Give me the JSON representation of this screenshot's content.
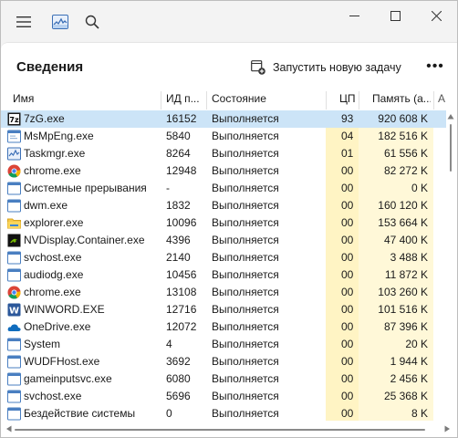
{
  "page": {
    "title": "Сведения",
    "new_task_label": "Запустить новую задачу",
    "more_label": "•••"
  },
  "columns": {
    "name": "Имя",
    "pid": "ИД п...",
    "status": "Состояние",
    "cpu": "ЦП",
    "memory": "Память (а..."
  },
  "rows": [
    {
      "name": "7zG.exe",
      "icon": "7zip-icon",
      "pid": "16152",
      "status": "Выполняется",
      "cpu": "93",
      "memory": "920 608 K",
      "selected": true
    },
    {
      "name": "MsMpEng.exe",
      "icon": "app-window-icon",
      "pid": "5840",
      "status": "Выполняется",
      "cpu": "04",
      "memory": "182 516 K"
    },
    {
      "name": "Taskmgr.exe",
      "icon": "task-manager-icon",
      "pid": "8264",
      "status": "Выполняется",
      "cpu": "01",
      "memory": "61 556 K"
    },
    {
      "name": "chrome.exe",
      "icon": "chrome-icon",
      "pid": "12948",
      "status": "Выполняется",
      "cpu": "00",
      "memory": "82 272 K"
    },
    {
      "name": "Системные прерывания",
      "icon": "system-window-icon",
      "pid": "-",
      "status": "Выполняется",
      "cpu": "00",
      "memory": "0 K"
    },
    {
      "name": "dwm.exe",
      "icon": "system-window-icon",
      "pid": "1832",
      "status": "Выполняется",
      "cpu": "00",
      "memory": "160 120 K"
    },
    {
      "name": "explorer.exe",
      "icon": "folder-icon",
      "pid": "10096",
      "status": "Выполняется",
      "cpu": "00",
      "memory": "153 664 K"
    },
    {
      "name": "NVDisplay.Container.exe",
      "icon": "nvidia-icon",
      "pid": "4396",
      "status": "Выполняется",
      "cpu": "00",
      "memory": "47 400 K"
    },
    {
      "name": "svchost.exe",
      "icon": "system-window-icon",
      "pid": "2140",
      "status": "Выполняется",
      "cpu": "00",
      "memory": "3 488 K"
    },
    {
      "name": "audiodg.exe",
      "icon": "system-window-icon",
      "pid": "10456",
      "status": "Выполняется",
      "cpu": "00",
      "memory": "11 872 K"
    },
    {
      "name": "chrome.exe",
      "icon": "chrome-icon",
      "pid": "13108",
      "status": "Выполняется",
      "cpu": "00",
      "memory": "103 260 K"
    },
    {
      "name": "WINWORD.EXE",
      "icon": "word-icon",
      "pid": "12716",
      "status": "Выполняется",
      "cpu": "00",
      "memory": "101 516 K"
    },
    {
      "name": "OneDrive.exe",
      "icon": "onedrive-icon",
      "pid": "12072",
      "status": "Выполняется",
      "cpu": "00",
      "memory": "87 396 K"
    },
    {
      "name": "System",
      "icon": "system-window-icon",
      "pid": "4",
      "status": "Выполняется",
      "cpu": "00",
      "memory": "20 K"
    },
    {
      "name": "WUDFHost.exe",
      "icon": "system-window-icon",
      "pid": "3692",
      "status": "Выполняется",
      "cpu": "00",
      "memory": "1 944 K"
    },
    {
      "name": "gameinputsvc.exe",
      "icon": "system-window-icon",
      "pid": "6080",
      "status": "Выполняется",
      "cpu": "00",
      "memory": "2 456 K"
    },
    {
      "name": "svchost.exe",
      "icon": "system-window-icon",
      "pid": "5696",
      "status": "Выполняется",
      "cpu": "00",
      "memory": "25 368 K"
    },
    {
      "name": "Бездействие системы",
      "icon": "system-window-icon",
      "pid": "0",
      "status": "Выполняется",
      "cpu": "00",
      "memory": "8 K"
    }
  ],
  "colors": {
    "selection": "#cce4f7",
    "cpu_shade": "#fff4c4",
    "mem_shade": "#fff8d8",
    "accent": "#2b6cb0"
  }
}
